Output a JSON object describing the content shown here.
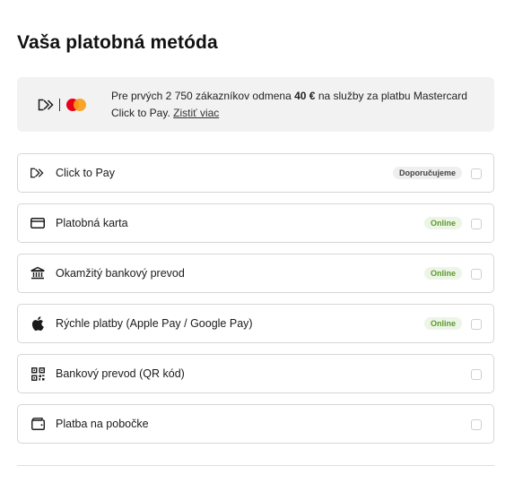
{
  "page": {
    "title": "Vaša platobná metóda"
  },
  "promo": {
    "icons": [
      "click-to-pay-icon",
      "mastercard-logo"
    ],
    "text_before": "Pre prvých 2 750 zákazníkov odmena ",
    "text_bold": "40 €",
    "text_after": " na služby za platbu Mastercard Click to Pay.",
    "link_label": "Zistiť viac"
  },
  "methods": [
    {
      "icon": "click-to-pay-icon",
      "label": "Click to Pay",
      "badge": "Doporučujeme",
      "badge_type": "recommended",
      "checked": false
    },
    {
      "icon": "credit-card-icon",
      "label": "Platobná karta",
      "badge": "Online",
      "badge_type": "online",
      "checked": false
    },
    {
      "icon": "bank-icon",
      "label": "Okamžitý bankový prevod",
      "badge": "Online",
      "badge_type": "online",
      "checked": false
    },
    {
      "icon": "apple-icon",
      "label": "Rýchle platby (Apple Pay / Google Pay)",
      "badge": "Online",
      "badge_type": "online",
      "checked": false
    },
    {
      "icon": "qr-code-icon",
      "label": "Bankový prevod (QR kód)",
      "badge": "",
      "badge_type": "",
      "checked": false
    },
    {
      "icon": "wallet-icon",
      "label": "Platba na pobočke",
      "badge": "",
      "badge_type": "",
      "checked": false
    }
  ],
  "colors": {
    "promo_bg": "#f2f2f2",
    "border": "#d6d6d6",
    "online_badge_bg": "#edf5e6",
    "online_badge_text": "#5b9a2e",
    "recommended_badge_bg": "#efefef",
    "mastercard_red": "#eb001b",
    "mastercard_orange": "#f79e1b"
  }
}
